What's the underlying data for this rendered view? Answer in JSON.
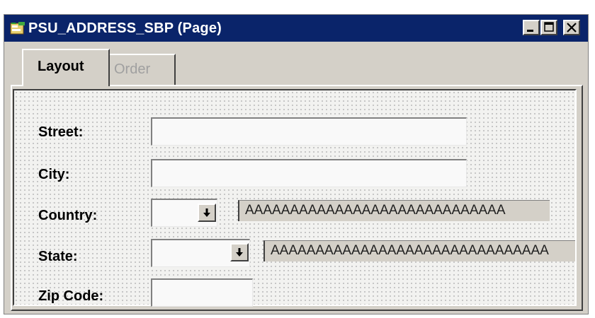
{
  "window": {
    "title": "PSU_ADDRESS_SBP (Page)"
  },
  "tabs": [
    {
      "label": "Layout",
      "active": true
    },
    {
      "label": "Order",
      "active": false
    }
  ],
  "fields": {
    "street": {
      "label": "Street:",
      "value": ""
    },
    "city": {
      "label": "City:",
      "value": ""
    },
    "country": {
      "label": "Country:",
      "value": "",
      "description": "AAAAAAAAAAAAAAAAAAAAAAAAAAAAA"
    },
    "state": {
      "label": "State:",
      "value": "",
      "description": "AAAAAAAAAAAAAAAAAAAAAAAAAAAAAAA"
    },
    "zip": {
      "label": "Zip Code:",
      "value": ""
    }
  },
  "icons": {
    "app": "page-definition-icon",
    "minimize": "minimize-icon",
    "maximize": "maximize-icon",
    "close": "close-icon",
    "dropdown": "arrow-down-icon"
  },
  "colors": {
    "titlebar": "#0a246a",
    "chrome": "#d4d0c8",
    "inactive_tab_text": "#a0a0a0"
  }
}
